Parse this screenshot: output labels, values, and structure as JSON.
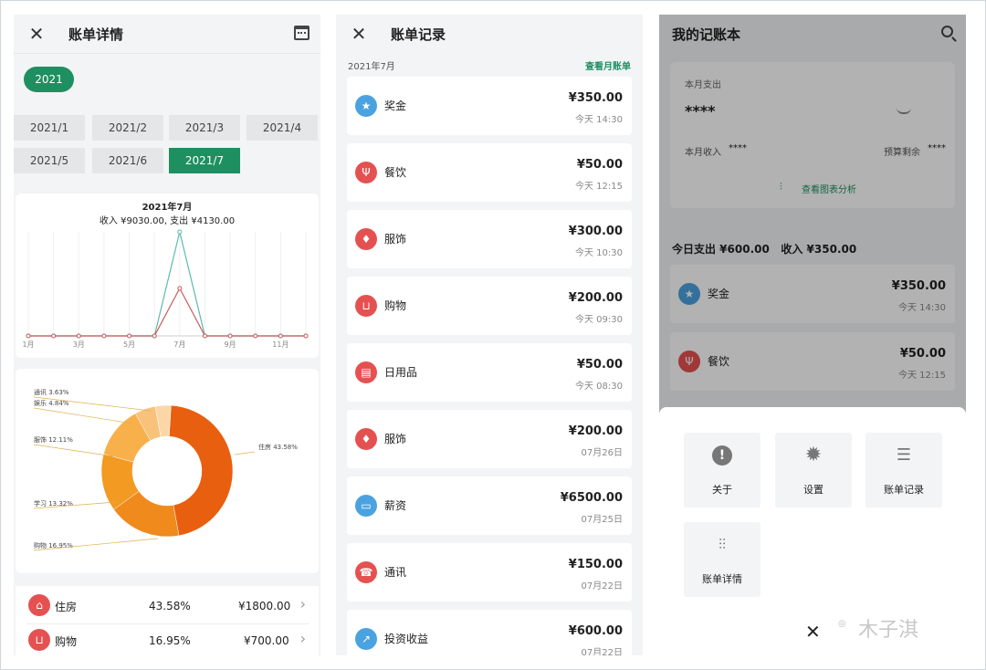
{
  "detail": {
    "title": "账单详情",
    "year": "2021",
    "months": [
      "2021/1",
      "2021/2",
      "2021/3",
      "2021/4",
      "2021/5",
      "2021/6",
      "2021/7"
    ],
    "selected_month": "2021/7",
    "line_title": "2021年7月",
    "line_subtitle": "收入 ¥9030.00, 支出 ¥4130.00",
    "x_ticks": [
      "1月",
      "3月",
      "5月",
      "7月",
      "9月",
      "11月"
    ],
    "pie_labels": [
      "通讯 3.63%",
      "娱乐 4.84%",
      "服饰 12.11%",
      "学习 13.32%",
      "购物 16.95%",
      "住房 43.58%"
    ],
    "rows": [
      {
        "name": "住房",
        "pct": "43.58%",
        "amount": "¥1800.00"
      },
      {
        "name": "购物",
        "pct": "16.95%",
        "amount": "¥700.00"
      }
    ]
  },
  "chart_data": [
    {
      "type": "line",
      "x": [
        1,
        2,
        3,
        4,
        5,
        6,
        7,
        8,
        9,
        10,
        11,
        12
      ],
      "series": [
        {
          "values": [
            0,
            0,
            0,
            0,
            0,
            0,
            9030,
            0,
            0,
            0,
            0,
            0
          ],
          "color": "#5fb9b0"
        },
        {
          "values": [
            0,
            0,
            0,
            0,
            0,
            0,
            4130,
            0,
            0,
            0,
            0,
            0
          ],
          "color": "#c85a5a"
        }
      ],
      "title": "2021年7月",
      "subtitle": "收入 ¥9030.00, 支出 ¥4130.00",
      "categories": [
        "1月",
        "3月",
        "5月",
        "7月",
        "9月",
        "11月"
      ]
    },
    {
      "type": "pie",
      "categories": [
        "住房",
        "购物",
        "学习",
        "服饰",
        "娱乐",
        "通讯"
      ],
      "values": [
        43.58,
        16.95,
        13.32,
        12.11,
        4.84,
        3.63
      ],
      "colors": [
        "#e85f10",
        "#f08a1c",
        "#f39a22",
        "#f7b04a",
        "#f9c27a",
        "#fbd7a8"
      ]
    }
  ],
  "records": {
    "title": "账单记录",
    "month": "2021年7月",
    "link": "查看月账单",
    "items": [
      {
        "name": "奖金",
        "amount": "¥350.00",
        "time": "今天 14:30",
        "color": "blue",
        "icon": "★"
      },
      {
        "name": "餐饮",
        "amount": "¥50.00",
        "time": "今天 12:15",
        "color": "red",
        "icon": "Ψ"
      },
      {
        "name": "服饰",
        "amount": "¥300.00",
        "time": "今天 10:30",
        "color": "red",
        "icon": "♦"
      },
      {
        "name": "购物",
        "amount": "¥200.00",
        "time": "今天 09:30",
        "color": "red",
        "icon": "⊔"
      },
      {
        "name": "日用品",
        "amount": "¥50.00",
        "time": "今天 08:30",
        "color": "red",
        "icon": "▤"
      },
      {
        "name": "服饰",
        "amount": "¥200.00",
        "time": "07月26日",
        "color": "red",
        "icon": "♦"
      },
      {
        "name": "薪资",
        "amount": "¥6500.00",
        "time": "07月25日",
        "color": "blue",
        "icon": "▭"
      },
      {
        "name": "通讯",
        "amount": "¥150.00",
        "time": "07月22日",
        "color": "red",
        "icon": "☎"
      },
      {
        "name": "投资收益",
        "amount": "¥600.00",
        "time": "07月22日",
        "color": "blue",
        "icon": "↗"
      }
    ]
  },
  "book": {
    "title": "我的记账本",
    "month_expense_label": "本月支出",
    "month_expense_value": "****",
    "month_income_label": "本月收入",
    "month_income_value": "****",
    "budget_label": "预算剩余",
    "budget_value": "****",
    "analysis_link": "查看图表分析",
    "today_summary": "今日支出 ¥600.00   收入 ¥350.00",
    "items": [
      {
        "name": "奖金",
        "amount": "¥350.00",
        "time": "今天 14:30",
        "color": "blue",
        "icon": "★"
      },
      {
        "name": "餐饮",
        "amount": "¥50.00",
        "time": "今天 12:15",
        "color": "red",
        "icon": "Ψ"
      }
    ],
    "menu": [
      "关于",
      "设置",
      "账单记录",
      "账单详情"
    ],
    "watermark": "木子淇"
  }
}
